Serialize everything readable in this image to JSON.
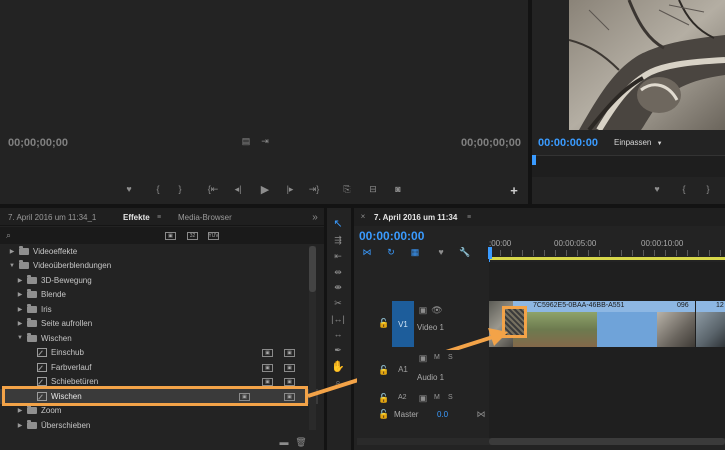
{
  "source_monitor": {
    "timecode": "00;00;00;00",
    "timecode_right": "00;00;00;00"
  },
  "program_monitor": {
    "timecode": "00:00:00:00",
    "fit_label": "Einpassen"
  },
  "effects_panel": {
    "tabs": [
      "7. April 2016 um 11:34_1",
      "Effekte",
      "Media-Browser"
    ],
    "tree": [
      {
        "label": "Videoeffekte",
        "level": 0,
        "type": "folder",
        "expanded": false
      },
      {
        "label": "Videoüberblendungen",
        "level": 0,
        "type": "folder",
        "expanded": true
      },
      {
        "label": "3D-Bewegung",
        "level": 1,
        "type": "folder",
        "expanded": false
      },
      {
        "label": "Blende",
        "level": 1,
        "type": "folder",
        "expanded": false
      },
      {
        "label": "Iris",
        "level": 1,
        "type": "folder",
        "expanded": false
      },
      {
        "label": "Seite aufrollen",
        "level": 1,
        "type": "folder",
        "expanded": false
      },
      {
        "label": "Wischen",
        "level": 1,
        "type": "folder",
        "expanded": true
      },
      {
        "label": "Einschub",
        "level": 2,
        "type": "effect"
      },
      {
        "label": "Farbverlauf",
        "level": 2,
        "type": "effect"
      },
      {
        "label": "Schiebetüren",
        "level": 2,
        "type": "effect"
      },
      {
        "label": "Wischen",
        "level": 2,
        "type": "effect",
        "selected": true
      },
      {
        "label": "Zoom",
        "level": 1,
        "type": "folder",
        "expanded": false
      },
      {
        "label": "Überschieben",
        "level": 1,
        "type": "folder",
        "expanded": false
      }
    ]
  },
  "timeline": {
    "tab_label": "7. April 2016 um 11:34",
    "timecode": "00:00:00:00",
    "ruler": [
      ":00:00",
      "00:00:05:00",
      "00:00:10:00"
    ],
    "tracks": {
      "v1_target": "V1",
      "video1": "Video 1",
      "a1": "A1",
      "audio1": "Audio 1",
      "a2": "A2",
      "master": "Master",
      "master_value": "0.0",
      "m": "M",
      "s": "S"
    },
    "clips": {
      "clip1_name": "7C5962E5-0BAA-46BB-A551",
      "clip2_name": "096",
      "clip3_name": "12"
    }
  },
  "colors": {
    "accent_blue": "#3a9bff",
    "highlight_orange": "#f3a348",
    "selected_track": "#1d5d9b"
  }
}
